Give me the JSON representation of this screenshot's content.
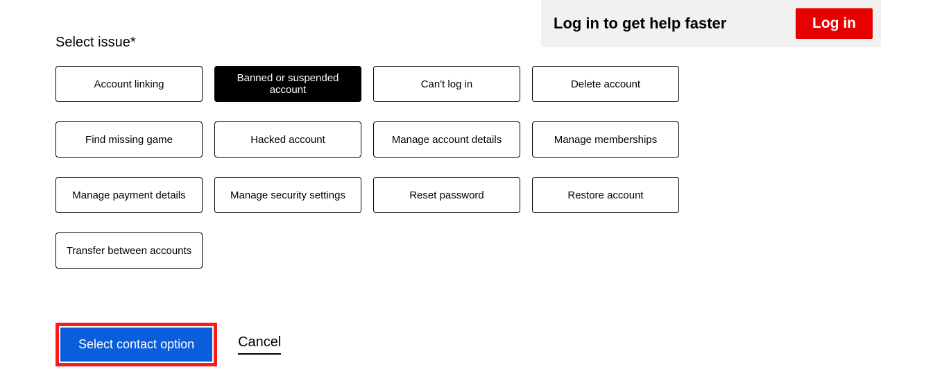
{
  "loginBar": {
    "message": "Log in to get help faster",
    "buttonLabel": "Log in"
  },
  "section": {
    "label": "Select issue*"
  },
  "issues": [
    {
      "label": "Account linking",
      "selected": false
    },
    {
      "label": "Banned or suspended account",
      "selected": true
    },
    {
      "label": "Can't log in",
      "selected": false
    },
    {
      "label": "Delete account",
      "selected": false
    },
    {
      "label": "Find missing game",
      "selected": false
    },
    {
      "label": "Hacked account",
      "selected": false
    },
    {
      "label": "Manage account details",
      "selected": false
    },
    {
      "label": "Manage memberships",
      "selected": false
    },
    {
      "label": "Manage payment details",
      "selected": false
    },
    {
      "label": "Manage security settings",
      "selected": false
    },
    {
      "label": "Reset password",
      "selected": false
    },
    {
      "label": "Restore account",
      "selected": false
    },
    {
      "label": "Transfer between accounts",
      "selected": false
    }
  ],
  "actions": {
    "primary": "Select contact option",
    "cancel": "Cancel"
  }
}
